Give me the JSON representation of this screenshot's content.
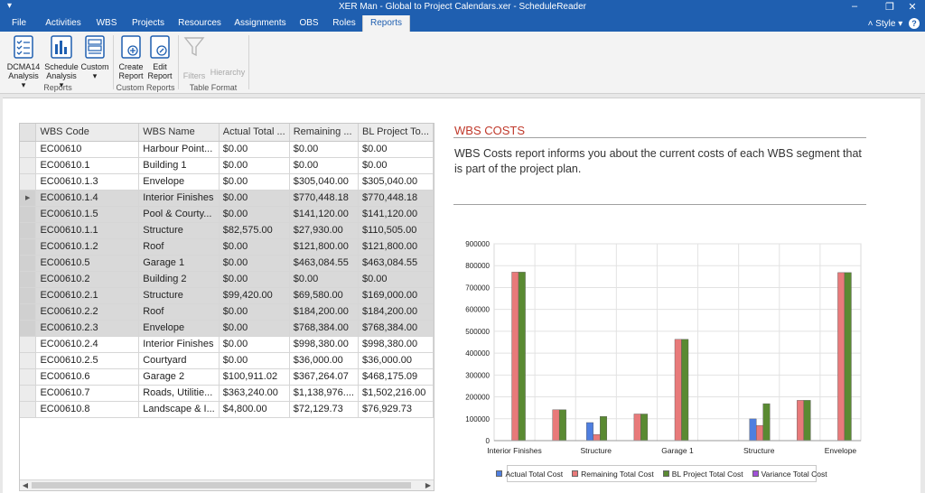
{
  "window": {
    "title": "XER Man - Global to Project Calendars.xer - ScheduleReader",
    "quick_access": "▾",
    "minimize": "–",
    "restore": "❐",
    "close": "✕"
  },
  "tabs": [
    {
      "label": "File"
    },
    {
      "label": "Activities"
    },
    {
      "label": "WBS"
    },
    {
      "label": "Projects"
    },
    {
      "label": "Resources"
    },
    {
      "label": "Assignments"
    },
    {
      "label": "OBS"
    },
    {
      "label": "Roles"
    },
    {
      "label": "Reports"
    }
  ],
  "active_tab": "Reports",
  "style_menu": {
    "label": "˄ Style ▾",
    "help": "?"
  },
  "ribbon": {
    "reports_group": {
      "label": "Reports",
      "dcma": {
        "line1": "DCMA14",
        "line2": "Analysis ▾"
      },
      "schedule": {
        "line1": "Schedule",
        "line2": "Analysis ▾"
      },
      "custom": {
        "line1": "Custom",
        "line2": "▾"
      }
    },
    "custom_group": {
      "label": "Custom Reports",
      "create": {
        "line1": "Create",
        "line2": "Report"
      },
      "edit": {
        "line1": "Edit",
        "line2": "Report"
      }
    },
    "format_group": {
      "label": "Table Format",
      "filters": "Filters",
      "hierarchy": "Hierarchy"
    }
  },
  "grid": {
    "columns": [
      "WBS Code",
      "WBS Name",
      "Actual Total ...",
      "Remaining ...",
      "BL Project To..."
    ],
    "rows": [
      [
        "EC00610",
        "Harbour Point...",
        "$0.00",
        "$0.00",
        "$0.00"
      ],
      [
        "EC00610.1",
        "Building 1",
        "$0.00",
        "$0.00",
        "$0.00"
      ],
      [
        "EC00610.1.3",
        "Envelope",
        "$0.00",
        "$305,040.00",
        "$305,040.00"
      ],
      [
        "EC00610.1.4",
        "Interior Finishes",
        "$0.00",
        "$770,448.18",
        "$770,448.18"
      ],
      [
        "EC00610.1.5",
        "Pool & Courty...",
        "$0.00",
        "$141,120.00",
        "$141,120.00"
      ],
      [
        "EC00610.1.1",
        "Structure",
        "$82,575.00",
        "$27,930.00",
        "$110,505.00"
      ],
      [
        "EC00610.1.2",
        "Roof",
        "$0.00",
        "$121,800.00",
        "$121,800.00"
      ],
      [
        "EC00610.5",
        "Garage 1",
        "$0.00",
        "$463,084.55",
        "$463,084.55"
      ],
      [
        "EC00610.2",
        "Building 2",
        "$0.00",
        "$0.00",
        "$0.00"
      ],
      [
        "EC00610.2.1",
        "Structure",
        "$99,420.00",
        "$69,580.00",
        "$169,000.00"
      ],
      [
        "EC00610.2.2",
        "Roof",
        "$0.00",
        "$184,200.00",
        "$184,200.00"
      ],
      [
        "EC00610.2.3",
        "Envelope",
        "$0.00",
        "$768,384.00",
        "$768,384.00"
      ],
      [
        "EC00610.2.4",
        "Interior Finishes",
        "$0.00",
        "$998,380.00",
        "$998,380.00"
      ],
      [
        "EC00610.2.5",
        "Courtyard",
        "$0.00",
        "$36,000.00",
        "$36,000.00"
      ],
      [
        "EC00610.6",
        "Garage 2",
        "$100,911.02",
        "$367,264.07",
        "$468,175.09"
      ],
      [
        "EC00610.7",
        "Roads, Utilitie...",
        "$363,240.00",
        "$1,138,976....",
        "$1,502,216.00"
      ],
      [
        "EC00610.8",
        "Landscape & I...",
        "$4,800.00",
        "$72,129.73",
        "$76,929.73"
      ]
    ],
    "highlighted_rows": [
      3,
      4,
      5,
      6,
      7,
      8,
      9,
      10,
      11
    ],
    "current_row": 3,
    "row_marker": "▶",
    "scroll_left": "◀",
    "scroll_right": "▶"
  },
  "report": {
    "title": "WBS COSTS",
    "description": "WBS Costs report informs you about the current costs of each WBS segment that is part of the project plan."
  },
  "colors": {
    "actual": "#4f7fe0",
    "remaining": "#e87a7a",
    "bl": "#5a8a32",
    "variance": "#a050d8",
    "ribbon_blue": "#1f5fb0",
    "title_red": "#c0392b"
  },
  "chart_data": {
    "type": "bar",
    "categories": [
      "Interior Finishes",
      "Pool & Courtyard",
      "Structure",
      "Roof",
      "Garage 1",
      "Building 2",
      "Structure",
      "Roof",
      "Envelope"
    ],
    "category_labels_shown": [
      "Interior Finishes",
      "",
      "Structure",
      "",
      "Garage 1",
      "",
      "Structure",
      "",
      "Envelope"
    ],
    "series": [
      {
        "name": "Actual Total Cost",
        "values": [
          0,
          0,
          82575,
          0,
          0,
          0,
          99420,
          0,
          0
        ]
      },
      {
        "name": "Remaining Total Cost",
        "values": [
          770448.18,
          141120,
          27930,
          121800,
          463084.55,
          0,
          69580,
          184200,
          768384
        ]
      },
      {
        "name": "BL Project Total Cost",
        "values": [
          770448.18,
          141120,
          110505,
          121800,
          463084.55,
          0,
          169000,
          184200,
          768384
        ]
      },
      {
        "name": "Variance Total Cost",
        "values": [
          0,
          0,
          0,
          0,
          0,
          0,
          0,
          0,
          0
        ]
      }
    ],
    "ylim": [
      0,
      900000
    ],
    "yticks": [
      0,
      100000,
      200000,
      300000,
      400000,
      500000,
      600000,
      700000,
      800000,
      900000
    ],
    "ytick_labels": [
      "0",
      "100000",
      "200000",
      "300000",
      "400000",
      "500000",
      "600000",
      "700000",
      "800000",
      "900000"
    ],
    "grid": true,
    "legend": "bottom"
  }
}
